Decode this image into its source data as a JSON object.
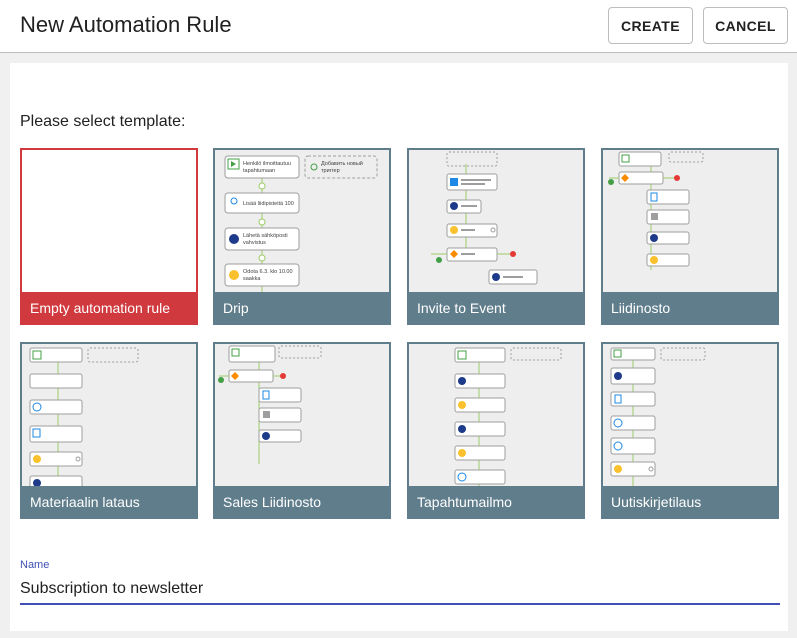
{
  "header": {
    "title": "New Automation Rule",
    "create_label": "CREATE",
    "cancel_label": "CANCEL"
  },
  "main": {
    "prompt": "Please select template:",
    "templates": [
      {
        "label": "Empty automation rule",
        "selected": true
      },
      {
        "label": "Drip",
        "selected": false
      },
      {
        "label": "Invite to Event",
        "selected": false
      },
      {
        "label": "Liidinosto",
        "selected": false
      },
      {
        "label": "Materiaalin lataus",
        "selected": false
      },
      {
        "label": "Sales Liidinosto",
        "selected": false
      },
      {
        "label": "Tapahtumailmo",
        "selected": false
      },
      {
        "label": "Uutiskirjetilaus",
        "selected": false
      }
    ],
    "drip_preview": {
      "step1": "Henkilö ilmoittautuu",
      "step1b": "tapahtumaan",
      "add_trigger_1": "Добавить новый",
      "add_trigger_2": "триггер",
      "step2": "Lisää liidipisteitä 100",
      "step3": "Lähetä sähköposti",
      "step3b": "vahvistus",
      "step4": "Odota 6.3. klo 10.00",
      "step4b": "saakka"
    }
  },
  "name_field": {
    "label": "Name",
    "value": "Subscription to newsletter"
  },
  "colors": {
    "accent": "#3f51b5",
    "card": "#607d8b",
    "selected": "#d0393e"
  }
}
